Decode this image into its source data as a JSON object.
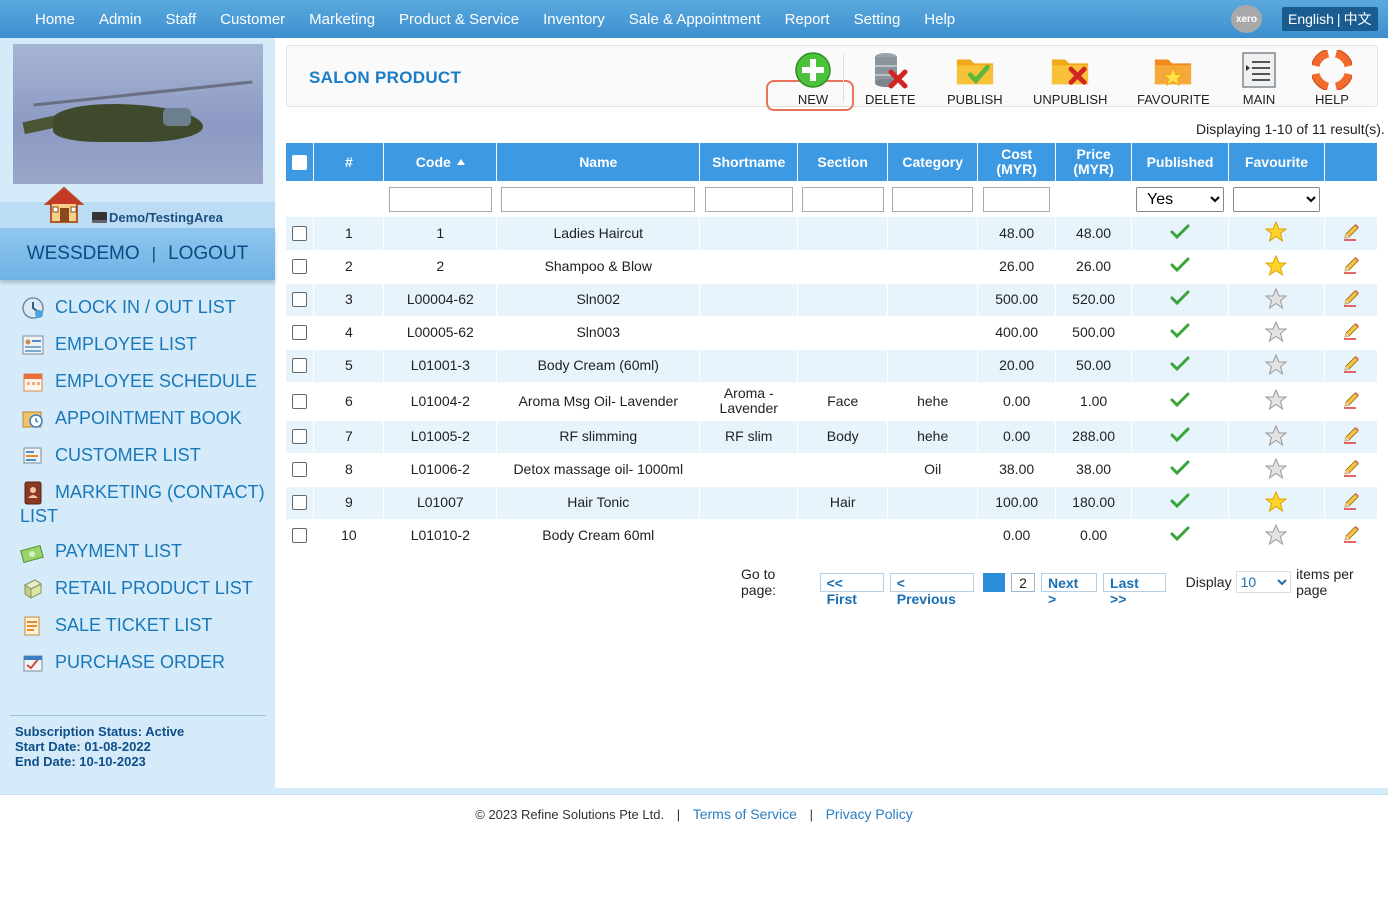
{
  "topnav": {
    "menu": [
      "Home",
      "Admin",
      "Staff",
      "Customer",
      "Marketing",
      "Product & Service",
      "Inventory",
      "Sale & Appointment",
      "Report",
      "Setting",
      "Help"
    ],
    "xero_label": "xero",
    "lang_english": "English",
    "lang_sep": "|",
    "lang_chinese": "中文"
  },
  "sidebar": {
    "area_label": "Demo/TestingArea",
    "username": "WESSDEMO",
    "login_sep": "|",
    "logout": "LOGOUT",
    "items": [
      {
        "label": "CLOCK IN / OUT LIST",
        "icon": "clock-icon"
      },
      {
        "label": "EMPLOYEE LIST",
        "icon": "employee-list-icon"
      },
      {
        "label": "EMPLOYEE SCHEDULE",
        "icon": "calendar-icon"
      },
      {
        "label": "APPOINTMENT BOOK",
        "icon": "appointment-book-icon"
      },
      {
        "label": "CUSTOMER LIST",
        "icon": "customer-list-icon"
      },
      {
        "label": "MARKETING (CONTACT) LIST",
        "icon": "contact-book-icon"
      },
      {
        "label": "PAYMENT LIST",
        "icon": "payment-icon"
      },
      {
        "label": "RETAIL PRODUCT LIST",
        "icon": "retail-product-icon"
      },
      {
        "label": "SALE TICKET LIST",
        "icon": "sale-ticket-icon"
      },
      {
        "label": "PURCHASE ORDER",
        "icon": "purchase-order-icon"
      }
    ],
    "subscription_status": "Subscription Status: Active",
    "start_date": "Start Date: 01-08-2022",
    "end_date": "End Date: 10-10-2023"
  },
  "page": {
    "title": "SALON PRODUCT",
    "toolbar": {
      "new": "NEW",
      "delete": "DELETE",
      "publish": "PUBLISH",
      "unpublish": "UNPUBLISH",
      "favourite": "FAVOURITE",
      "main": "MAIN",
      "help": "HELP"
    },
    "result_count": "Displaying 1-10 of 11 result(s)."
  },
  "table": {
    "headers": {
      "num": "#",
      "code": "Code",
      "name": "Name",
      "shortname": "Shortname",
      "section": "Section",
      "category": "Category",
      "cost_l1": "Cost",
      "cost_l2": "(MYR)",
      "price_l1": "Price",
      "price_l2": "(MYR)",
      "published": "Published",
      "favourite": "Favourite"
    },
    "filter": {
      "published_value": "Yes",
      "favourite_value": ""
    },
    "rows": [
      {
        "num": "1",
        "code": "1",
        "name": "Ladies Haircut",
        "shortname": "",
        "section": "",
        "category": "",
        "cost": "48.00",
        "price": "48.00",
        "published": true,
        "favourite": true
      },
      {
        "num": "2",
        "code": "2",
        "name": "Shampoo & Blow",
        "shortname": "",
        "section": "",
        "category": "",
        "cost": "26.00",
        "price": "26.00",
        "published": true,
        "favourite": true
      },
      {
        "num": "3",
        "code": "L00004-62",
        "name": "Sln002",
        "shortname": "",
        "section": "",
        "category": "",
        "cost": "500.00",
        "price": "520.00",
        "published": true,
        "favourite": false
      },
      {
        "num": "4",
        "code": "L00005-62",
        "name": "Sln003",
        "shortname": "",
        "section": "",
        "category": "",
        "cost": "400.00",
        "price": "500.00",
        "published": true,
        "favourite": false
      },
      {
        "num": "5",
        "code": "L01001-3",
        "name": "Body Cream (60ml)",
        "shortname": "",
        "section": "",
        "category": "",
        "cost": "20.00",
        "price": "50.00",
        "published": true,
        "favourite": false
      },
      {
        "num": "6",
        "code": "L01004-2",
        "name": "Aroma Msg Oil- Lavender",
        "shortname": "Aroma - Lavender",
        "section": "Face",
        "category": "hehe",
        "cost": "0.00",
        "price": "1.00",
        "published": true,
        "favourite": false
      },
      {
        "num": "7",
        "code": "L01005-2",
        "name": "RF slimming",
        "shortname": "RF slim",
        "section": "Body",
        "category": "hehe",
        "cost": "0.00",
        "price": "288.00",
        "published": true,
        "favourite": false
      },
      {
        "num": "8",
        "code": "L01006-2",
        "name": "Detox massage oil- 1000ml",
        "shortname": "",
        "section": "",
        "category": "Oil",
        "cost": "38.00",
        "price": "38.00",
        "published": true,
        "favourite": false
      },
      {
        "num": "9",
        "code": "L01007",
        "name": "Hair Tonic",
        "shortname": "",
        "section": "Hair",
        "category": "",
        "cost": "100.00",
        "price": "180.00",
        "published": true,
        "favourite": true
      },
      {
        "num": "10",
        "code": "L01010-2",
        "name": "Body Cream 60ml",
        "shortname": "",
        "section": "",
        "category": "",
        "cost": "0.00",
        "price": "0.00",
        "published": true,
        "favourite": false
      }
    ]
  },
  "pager": {
    "goto_label": "Go to page:",
    "first": "<< First",
    "previous": "< Previous",
    "current_page": "1",
    "page2": "2",
    "next": "Next >",
    "last": "Last >>",
    "display_label": "Display",
    "per_page": "10",
    "items_label": "items per page"
  },
  "footer": {
    "copyright": "© 2023 Refine Solutions Pte Ltd.",
    "sep": "|",
    "terms": "Terms of Service",
    "privacy": "Privacy Policy"
  }
}
